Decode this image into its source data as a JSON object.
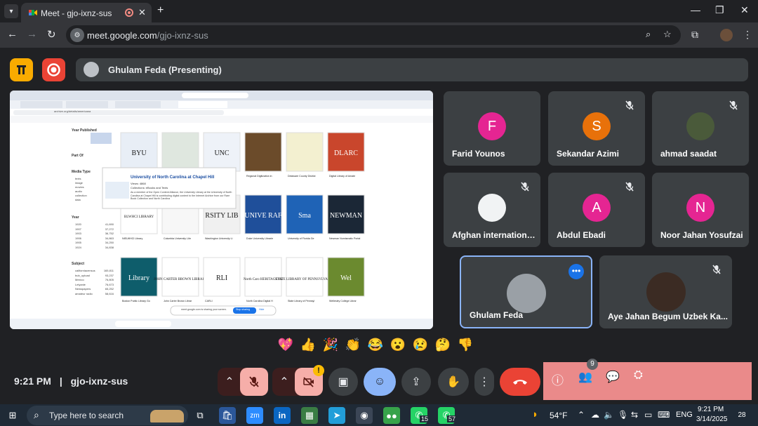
{
  "browser": {
    "tab_title": "Meet - gjo-ixnz-sus",
    "new_tab_label": "+",
    "url_domain": "meet.google.com",
    "url_path": "/gjo-ixnz-sus"
  },
  "meet": {
    "presenter_label": "Ghulam Feda (Presenting)",
    "participants": [
      {
        "name": "Farid Younos",
        "initial": "F",
        "color": "#e52592",
        "muted": false
      },
      {
        "name": "Sekandar Azimi",
        "initial": "S",
        "color": "#e8710a",
        "muted": true
      },
      {
        "name": "ahmad saadat",
        "initial": "",
        "color": "#4a5a3a",
        "muted": true
      },
      {
        "name": "Afghan international...",
        "initial": "",
        "color": "#f1f3f4",
        "muted": true
      },
      {
        "name": "Abdul Ebadi",
        "initial": "A",
        "color": "#e52592",
        "muted": true
      },
      {
        "name": "Noor Jahan Yosufzai",
        "initial": "N",
        "color": "#e52592",
        "muted": false
      },
      {
        "name": "Ghulam Feda",
        "initial": "",
        "color": "#9aa0a6",
        "muted": false
      },
      {
        "name": "Aye Jahan Begum Uzbek Ka...",
        "initial": "",
        "color": "#3b2b23",
        "muted": true
      }
    ],
    "reactions": [
      "💖",
      "👍",
      "🎉",
      "👏",
      "😂",
      "😮",
      "😢",
      "🤔",
      "👎"
    ],
    "meeting_time": "9:21 PM",
    "meeting_separator": "|",
    "meeting_code": "gjo-ixnz-sus",
    "people_count": "9",
    "alert_badge": "!"
  },
  "shared_screen": {
    "url": "archive.org/details/americana",
    "sidebar_heading_year": "Year Published",
    "sidebar_part_of": "Part Of",
    "sidebar_media_type": "Media Type",
    "media_types": [
      "texts",
      "image",
      "movies",
      "audio",
      "collection",
      "data"
    ],
    "sidebar_year": "Year",
    "years": [
      [
        "1920",
        "41,690"
      ],
      [
        "1907",
        "37,272"
      ],
      [
        "1903",
        "36,752"
      ],
      [
        "1906",
        "34,863"
      ],
      [
        "1905",
        "34,250"
      ],
      [
        "1924",
        "34,838"
      ]
    ],
    "sidebar_subject": "Subject",
    "subjects": [
      [
        "californiacensus",
        "165,811"
      ],
      [
        "bub_upload",
        "93,237"
      ],
      [
        "Mexico",
        "76,805"
      ],
      [
        "Lelyanie",
        "76,673"
      ],
      [
        "Newspapers",
        "65,252"
      ],
      [
        "amateur radio",
        "58,616"
      ]
    ],
    "more_label": "More",
    "popup_title": "University of North Carolina at Chapel Hill",
    "popup_views": "Views: 4868",
    "popup_collections": "Collections: eBooks and Texts",
    "popup_text": "As a member of the Open Content Alliance, the University Library at the University of North Carolina at Chapel Hill is contributing digital content to the Internet Archive from our Rare Book Collection and North Carolina",
    "library_cards": [
      {
        "title": "BYU",
        "label": "",
        "bg": "#e8eef6"
      },
      {
        "title": "",
        "label": "",
        "bg": "#dfe7df"
      },
      {
        "title": "UNC",
        "label": "",
        "bg": "#eef2f8"
      },
      {
        "title": "",
        "label": "Regional Digitization in Massachusetts",
        "bg": "#6b4b2a"
      },
      {
        "title": "",
        "label": "Delaware County District Library (Ohio)",
        "bg": "#f3f0d0"
      },
      {
        "title": "DLARC",
        "label": "Digital Library of Amateur Radio & Communications",
        "bg": "#c9462c"
      },
      {
        "title": "BLWHCI LIBRARY",
        "label": "NIELWHCI Library",
        "bg": "#ffffff"
      },
      {
        "title": "",
        "label": "Columbia University Libraries",
        "bg": "#f7f7f7"
      },
      {
        "title": "RSITY LIB",
        "label": "Washington University Libraries",
        "bg": "#f0f0f0"
      },
      {
        "title": "UNIVE RAF",
        "label": "Duke University Libraries",
        "bg": "#1f4f9a"
      },
      {
        "title": "Sma",
        "label": "University of Florida George A. Smathers Libraries",
        "bg": "#1f63b6"
      },
      {
        "title": "NEWMAN",
        "label": "Newman Numismatic Portal",
        "bg": "#1b2736"
      },
      {
        "title": "Library",
        "label": "Boston Public Library Government Documents",
        "bg": "#0e5d6b"
      },
      {
        "title": "JOHN CARTER BROWN LIBRARY",
        "label": "John Carter Brown Library",
        "bg": "#ffffff"
      },
      {
        "title": "RLI",
        "label": "CARLI",
        "bg": "#ffffff"
      },
      {
        "title": "North Caro HERITAGE CE",
        "label": "North Carolina Digital Heritage Center",
        "bg": "#ffffff"
      },
      {
        "title": "STATE LIBRARY OF PENNSYLVANIA",
        "label": "State Library of Pennsylvania",
        "bg": "#ffffff"
      },
      {
        "title": "Wel",
        "label": "Wellesley College Library",
        "bg": "#6b8a2f"
      }
    ],
    "share_bar_text": "meet.google.com is sharing your screen.",
    "stop_sharing": "Stop sharing",
    "hide": "Hide"
  },
  "taskbar": {
    "search_placeholder": "Type here to search",
    "whatsapp_badge_1": "15",
    "whatsapp_badge_2": "57",
    "temperature": "54°F",
    "language": "ENG",
    "clock_time": "9:21 PM",
    "clock_date": "3/14/2025",
    "notification_count": "28"
  }
}
